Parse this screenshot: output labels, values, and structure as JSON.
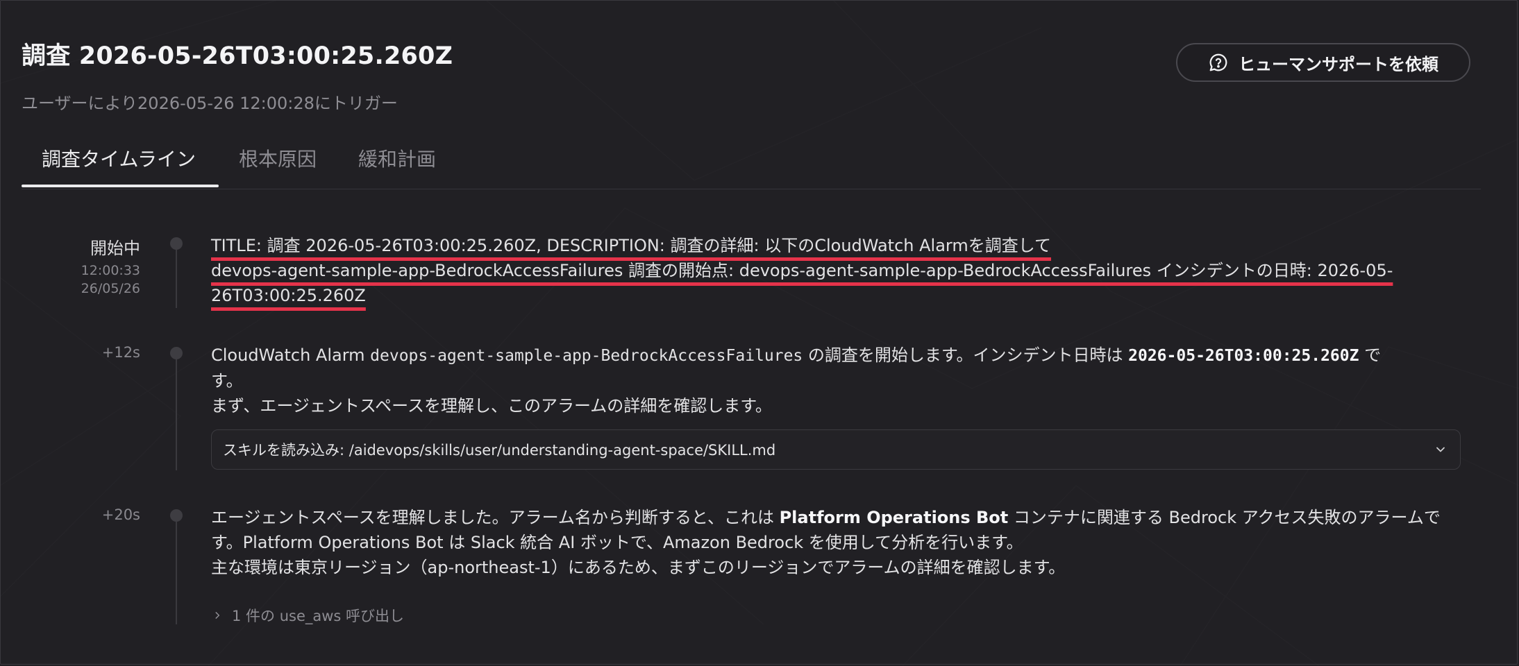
{
  "header": {
    "title": "調査 2026-05-26T03:00:25.260Z",
    "subtitle": "ユーザーにより2026-05-26 12:00:28にトリガー",
    "help_button": "ヒューマンサポートを依頼",
    "help_icon": "question-chat-icon"
  },
  "tabs": [
    {
      "label": "調査タイムライン",
      "active": true
    },
    {
      "label": "根本原因",
      "active": false
    },
    {
      "label": "緩和計画",
      "active": false
    }
  ],
  "events": [
    {
      "status": "開始中",
      "time": "12:00:33",
      "date": "26/05/26",
      "text": {
        "l1": "TITLE: 調査 2026-05-26T03:00:25.260Z, DESCRIPTION: 調査の詳細: 以下のCloudWatch Alarmを調査して",
        "l2": "devops-agent-sample-app-BedrockAccessFailures 調査の開始点: devops-agent-sample-app-BedrockAccessFailures インシデントの日時: 2026-05-",
        "l3": "26T03:00:25.260Z"
      }
    },
    {
      "rel": "+12s",
      "p1_a": "CloudWatch Alarm ",
      "p1_code": "devops-agent-sample-app-BedrockAccessFailures",
      "p1_b": " の調査を開始します。インシデント日時は ",
      "p1_code2": "2026-05-26T03:00:25.260Z",
      "p1_c": " で",
      "p1_d": "す。",
      "p2": "まず、エージェントスペースを理解し、このアラームの詳細を確認します。",
      "skill": "スキルを読み込み: /aidevops/skills/user/understanding-agent-space/SKILL.md"
    },
    {
      "rel": "+20s",
      "p1_a": "エージェントスペースを理解しました。アラーム名から判断すると、これは ",
      "p1_bold": "Platform Operations Bot",
      "p1_b": " コンテナに関連する Bedrock アクセス失敗のアラームで",
      "p2": "す。Platform Operations Bot は Slack 統合 AI ボットで、Amazon Bedrock を使用して分析を行います。",
      "p3": "主な環境は東京リージョン（ap-northeast-1）にあるため、まずこのリージョンでアラームの詳細を確認します。",
      "calls": "1 件の use_aws 呼び出し"
    }
  ],
  "colors": {
    "background": "#212024",
    "highlight_underline": "#e5334a",
    "muted_text": "#8e8d93"
  }
}
